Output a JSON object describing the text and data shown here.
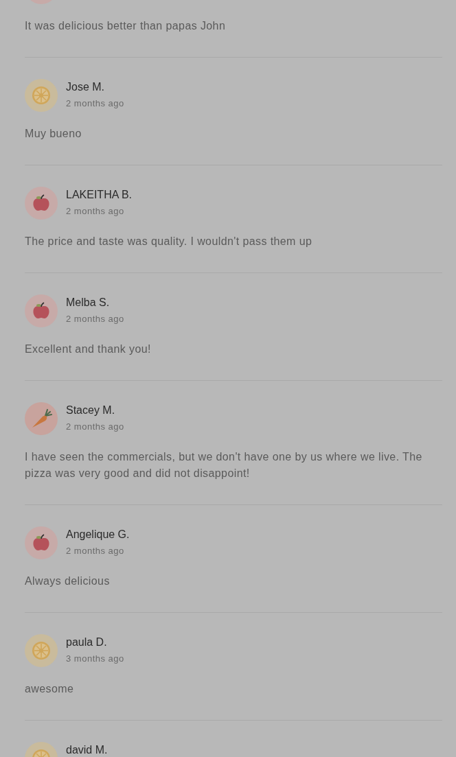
{
  "reviews": [
    {
      "avatar": {
        "kind": "blank"
      },
      "comment": "It was delicious better than papas John"
    },
    {
      "avatar": {
        "kind": "citrus"
      },
      "name": "Jose M.",
      "time": "2 months ago",
      "comment": "Muy bueno"
    },
    {
      "avatar": {
        "kind": "apple"
      },
      "name": "LAKEITHA B.",
      "time": "2 months ago",
      "comment": "The price and taste was quality. I wouldn't pass them up"
    },
    {
      "avatar": {
        "kind": "apple"
      },
      "name": "Melba S.",
      "time": "2 months ago",
      "comment": "Excellent and thank you!"
    },
    {
      "avatar": {
        "kind": "carrot"
      },
      "name": "Stacey M.",
      "time": "2 months ago",
      "comment": "I have seen the commercials, but we don't have one by us where we live. The pizza was very good and did not disappoint!"
    },
    {
      "avatar": {
        "kind": "apple"
      },
      "name": "Angelique G.",
      "time": "2 months ago",
      "comment": "Always delicious"
    },
    {
      "avatar": {
        "kind": "citrus"
      },
      "name": "paula D.",
      "time": "3 months ago",
      "comment": "awesome"
    },
    {
      "avatar": {
        "kind": "citrus"
      },
      "name": "david M."
    }
  ]
}
